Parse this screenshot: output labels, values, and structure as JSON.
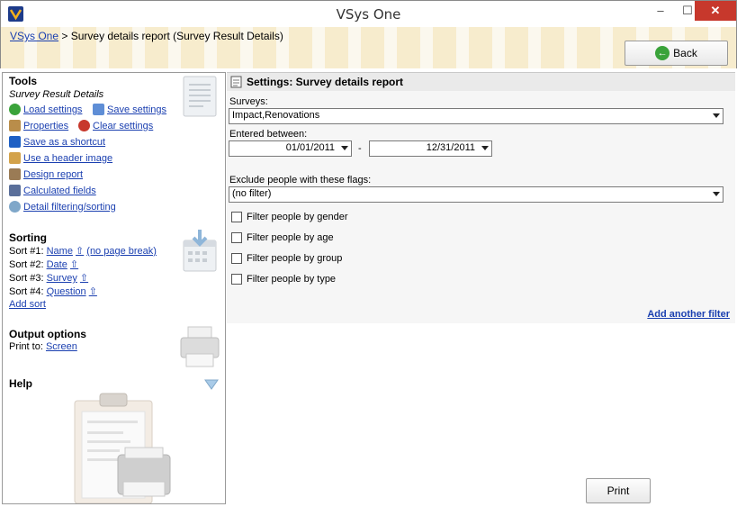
{
  "window": {
    "title": "VSys One",
    "min": "–",
    "max": "☐",
    "close": "✕"
  },
  "breadcrumb": {
    "root": "VSys One",
    "sep": ">",
    "current": "Survey details report (Survey Result Details)"
  },
  "back_button": {
    "label": "Back"
  },
  "left": {
    "tools": {
      "title": "Tools",
      "subtitle": "Survey Result Details",
      "load": "Load settings",
      "save": "Save settings",
      "properties": "Properties",
      "clear": "Clear settings",
      "shortcut": "Save as a shortcut",
      "header_image": "Use a header image",
      "design": "Design report",
      "calculated": "Calculated fields",
      "detail": "Detail filtering/sorting"
    },
    "sorting": {
      "title": "Sorting",
      "rows": [
        {
          "prefix": "Sort #1:",
          "field": "Name",
          "arrow": "⇧",
          "extra": "(no page break)"
        },
        {
          "prefix": "Sort #2:",
          "field": "Date",
          "arrow": "⇧"
        },
        {
          "prefix": "Sort #3:",
          "field": "Survey",
          "arrow": "⇧"
        },
        {
          "prefix": "Sort #4:",
          "field": "Question",
          "arrow": "⇧"
        }
      ],
      "add": "Add sort"
    },
    "output": {
      "title": "Output options",
      "print_to_label": "Print to:",
      "print_to_value": "Screen"
    },
    "help": {
      "title": "Help"
    }
  },
  "right": {
    "header": "Settings: Survey details report",
    "surveys_label": "Surveys:",
    "surveys_value": "Impact,Renovations",
    "entered_label": "Entered between:",
    "date_from": "01/01/2011",
    "date_sep": "-",
    "date_to": "12/31/2011",
    "flags_label": "Exclude people with these flags:",
    "flags_value": "(no filter)",
    "filters": [
      "Filter people by gender",
      "Filter people by age",
      "Filter people by group",
      "Filter people by type"
    ],
    "add_filter": "Add another filter",
    "print": "Print"
  },
  "colors": {
    "link": "#1a3fb0",
    "close_btn": "#c7382c",
    "band": "#fbf8ee"
  }
}
